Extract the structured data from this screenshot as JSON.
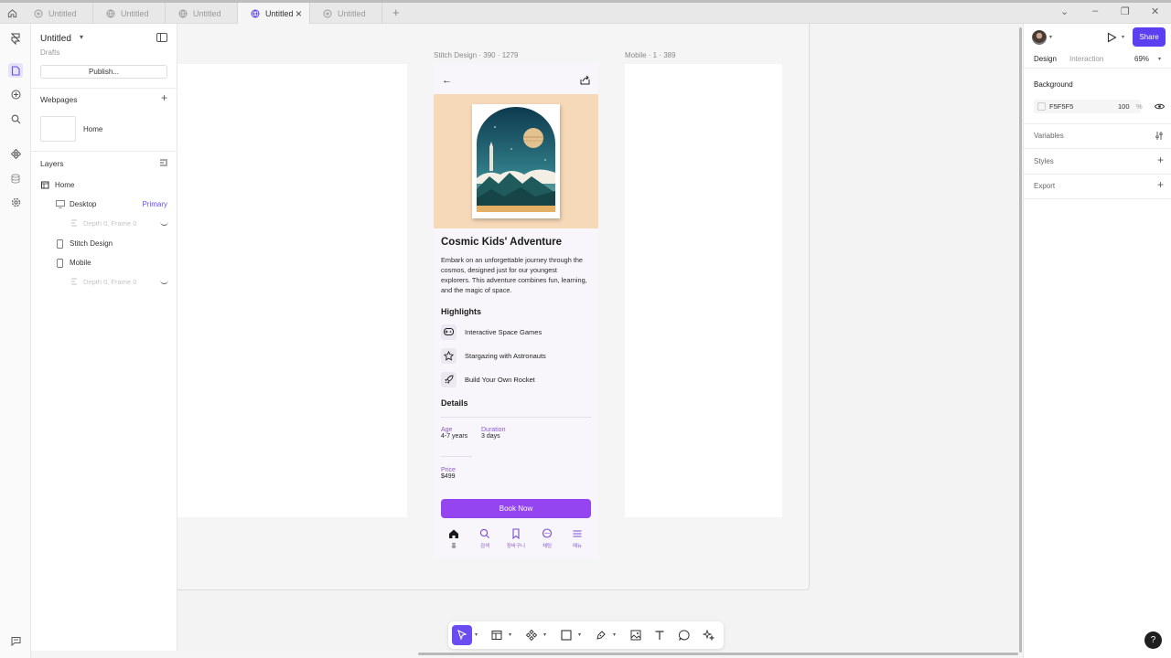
{
  "tabs": [
    {
      "label": "Untitled",
      "icon": "component-icon",
      "active": false
    },
    {
      "label": "Untitled",
      "icon": "globe-icon",
      "active": false
    },
    {
      "label": "Untitled",
      "icon": "globe-icon",
      "active": false
    },
    {
      "label": "Untitled",
      "icon": "globe-icon",
      "active": true
    },
    {
      "label": "Untitled",
      "icon": "component-icon",
      "active": false
    }
  ],
  "left_panel": {
    "title": "Untitled",
    "subtitle": "Drafts",
    "publish_label": "Publish...",
    "webpages_heading": "Webpages",
    "webpage_name": "Home",
    "layers_heading": "Layers",
    "layers": [
      {
        "label": "Home"
      },
      {
        "label": "Desktop",
        "tag": "Primary"
      },
      {
        "label": "Depth 0, Frame 0"
      },
      {
        "label": "Stitch Design"
      },
      {
        "label": "Mobile"
      },
      {
        "label": "Depth 0, Frame 0"
      }
    ]
  },
  "canvas": {
    "stitch_label": "Stitch Design · 390 · 1279",
    "mobile_label": "Mobile · 1 · 389"
  },
  "phone": {
    "title": "Cosmic Kids' Adventure",
    "description": "Embark on an unforgettable journey through the cosmos, designed just for our youngest explorers. This adventure combines fun, learning, and the magic of space.",
    "highlights_heading": "Highlights",
    "highlights": [
      {
        "label": "Interactive Space Games",
        "icon": "gamepad-icon"
      },
      {
        "label": "Stargazing with Astronauts",
        "icon": "star-icon"
      },
      {
        "label": "Build Your Own Rocket",
        "icon": "rocket-icon"
      }
    ],
    "details_heading": "Details",
    "details": {
      "age_label": "Age",
      "age_value": "4-7 years",
      "duration_label": "Duration",
      "duration_value": "3 days",
      "price_label": "Price",
      "price_value": "$499"
    },
    "book_label": "Book Now",
    "bottom_nav": [
      {
        "label": "홈",
        "icon": "home-icon"
      },
      {
        "label": "검색",
        "icon": "search-icon"
      },
      {
        "label": "장바구니",
        "icon": "bookmark-icon"
      },
      {
        "label": "채팅",
        "icon": "chat-icon"
      },
      {
        "label": "메뉴",
        "icon": "menu-icon"
      }
    ]
  },
  "right_panel": {
    "share_label": "Share",
    "tab_design": "Design",
    "tab_interaction": "Interaction",
    "zoom": "69%",
    "background_heading": "Background",
    "bg_hex": "F5F5F5",
    "bg_opacity": "100",
    "bg_pct": "%",
    "variables_heading": "Variables",
    "styles_heading": "Styles",
    "export_heading": "Export"
  },
  "help_label": "?",
  "colors": {
    "accent": "#6a4cf0",
    "book_button": "#9445f0",
    "hero_bg": "#f6d9b9",
    "share_button": "#5b3ff0"
  }
}
